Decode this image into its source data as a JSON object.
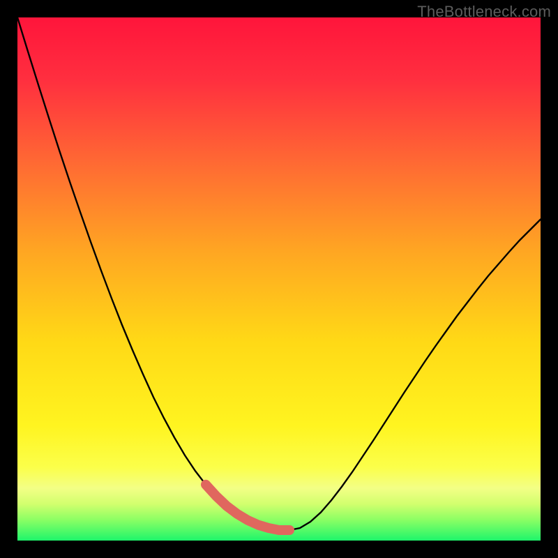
{
  "watermark": "TheBottleneck.com",
  "colors": {
    "gradient_top": "#ff153b",
    "gradient_bottom": "#1ef56b",
    "curve_stroke": "#000000",
    "highlight_stroke": "#e0675e",
    "background_frame": "#000000",
    "watermark_text": "#5c5c5c"
  },
  "chart_data": {
    "type": "line",
    "title": "",
    "xlabel": "",
    "ylabel": "",
    "xlim": [
      0,
      100
    ],
    "ylim": [
      0,
      100
    ],
    "x": [
      0,
      2,
      4,
      6,
      8,
      10,
      12,
      14,
      16,
      18,
      20,
      22,
      24,
      26,
      28,
      30,
      32,
      34,
      36,
      38,
      40,
      42,
      44,
      46,
      48,
      50,
      52,
      54,
      56,
      58,
      60,
      62,
      64,
      66,
      68,
      70,
      72,
      74,
      76,
      78,
      80,
      82,
      84,
      86,
      88,
      90,
      92,
      94,
      96,
      98,
      100
    ],
    "series": [
      {
        "name": "bottleneck_curve",
        "values": [
          100.0,
          93.5,
          87.1,
          80.8,
          74.6,
          68.6,
          62.8,
          57.1,
          51.6,
          46.3,
          41.2,
          36.4,
          31.8,
          27.4,
          23.4,
          19.7,
          16.3,
          13.3,
          10.7,
          8.5,
          6.6,
          5.1,
          3.9,
          3.0,
          2.4,
          2.0,
          2.0,
          2.4,
          3.6,
          5.4,
          7.7,
          10.3,
          13.1,
          16.1,
          19.1,
          22.2,
          25.3,
          28.4,
          31.4,
          34.4,
          37.3,
          40.1,
          42.9,
          45.5,
          48.1,
          50.6,
          52.9,
          55.2,
          57.4,
          59.4,
          61.4
        ]
      }
    ],
    "highlight_range_x": [
      36,
      52
    ],
    "annotations": []
  }
}
